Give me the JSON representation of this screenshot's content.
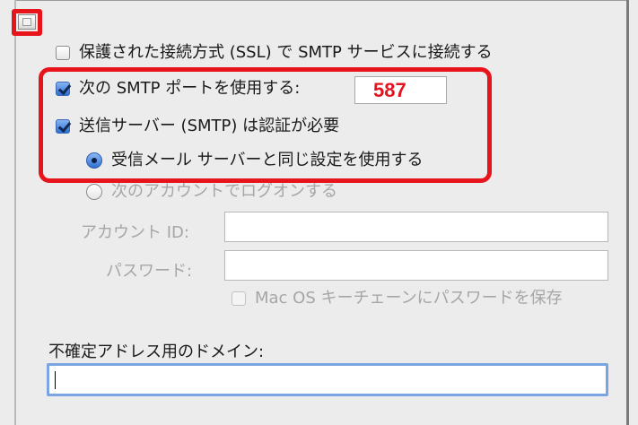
{
  "options": {
    "ssl": {
      "label": "保護された接続方式 (SSL) で SMTP サービスに接続する",
      "checked": false
    },
    "port": {
      "label": "次の SMTP ポートを使用する:",
      "checked": true,
      "value": "587"
    },
    "auth": {
      "label": "送信サーバー (SMTP) は認証が必要",
      "checked": true
    },
    "same_settings": {
      "label": "受信メール サーバーと同じ設定を使用する",
      "selected": true
    },
    "other_account": {
      "label": "次のアカウントでログオンする",
      "selected": false
    }
  },
  "account": {
    "label": "アカウント ID:",
    "value": ""
  },
  "password": {
    "label": "パスワード:",
    "value": ""
  },
  "keychain": {
    "label": "Mac OS キーチェーンにパスワードを保存",
    "checked": false
  },
  "domain": {
    "label": "不確定アドレス用のドメイン:",
    "value": ""
  },
  "colors": {
    "highlight": "#e8141b",
    "port_value": "#e2141f",
    "focus_ring": "#7aa5e2"
  }
}
